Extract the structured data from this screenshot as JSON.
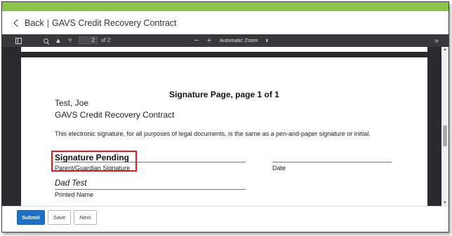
{
  "header": {
    "back_label": "Back",
    "separator": "|",
    "title": "GAVS Credit Recovery Contract"
  },
  "toolbar": {
    "page_number": "2",
    "page_of": "of 2",
    "zoom_out": "−",
    "zoom_in": "+",
    "zoom_value": "Automatic Zoom",
    "zoom_caret": "⬍",
    "more": "»"
  },
  "document": {
    "title": "Signature Page, page 1 of 1",
    "student_name": "Test, Joe",
    "contract_name": "GAVS Credit Recovery Contract",
    "statement": "This electronic signature, for all purposes of legal documents, is the same as a pen-and-paper signature or initial.",
    "signature_status": "Signature Pending",
    "signature_label": "Parent/Guardian Signature",
    "date_label": "Date",
    "printed_name_value": "Dad Test",
    "printed_name_label": "Printed Name"
  },
  "footer": {
    "submit_label": "Submit",
    "save_label": "Save",
    "next_label": "Next"
  },
  "colors": {
    "top_accent": "#8bc34a",
    "toolbar_bg": "#38383d",
    "submit_bg": "#1f6fc5",
    "highlight": "#e01b24"
  },
  "icons": [
    "chevron-left-icon",
    "sidebar-toggle-icon",
    "search-icon",
    "arrow-up-icon",
    "arrow-down-icon",
    "double-chevron-right-icon"
  ]
}
